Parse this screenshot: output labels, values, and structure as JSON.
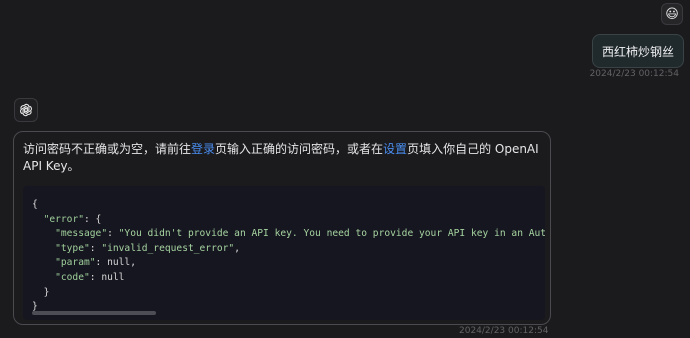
{
  "user_message": {
    "avatar_emoji": "😃",
    "text": "西红柿炒钢丝",
    "timestamp": "2024/2/23 00:12:54"
  },
  "bot_message": {
    "avatar_icon": "openai-logo-icon",
    "text_part1": "访问密码不正确或为空，请前往",
    "link_login": "登录",
    "text_part2": "页输入正确的访问密码，或者在",
    "link_settings": "设置",
    "text_part3": "页填入你自己的 OpenAI API Key。",
    "code": {
      "line1": "{",
      "line2_key": "\"error\"",
      "line2_rest": ": {",
      "line3_key": "\"message\"",
      "line3_val": "\"You didn't provide an API key. You need to provide your API key in an Autho",
      "line4_key": "\"type\"",
      "line4_val": "\"invalid_request_error\"",
      "line5_key": "\"param\"",
      "line5_val": "null",
      "line6_key": "\"code\"",
      "line6_val": "null",
      "line7": "}",
      "line8": "}"
    },
    "timestamp": "2024/2/23 00:12:54"
  },
  "colors": {
    "background": "#1b1b1d",
    "link": "#4a8df0",
    "code_background": "#161620"
  }
}
